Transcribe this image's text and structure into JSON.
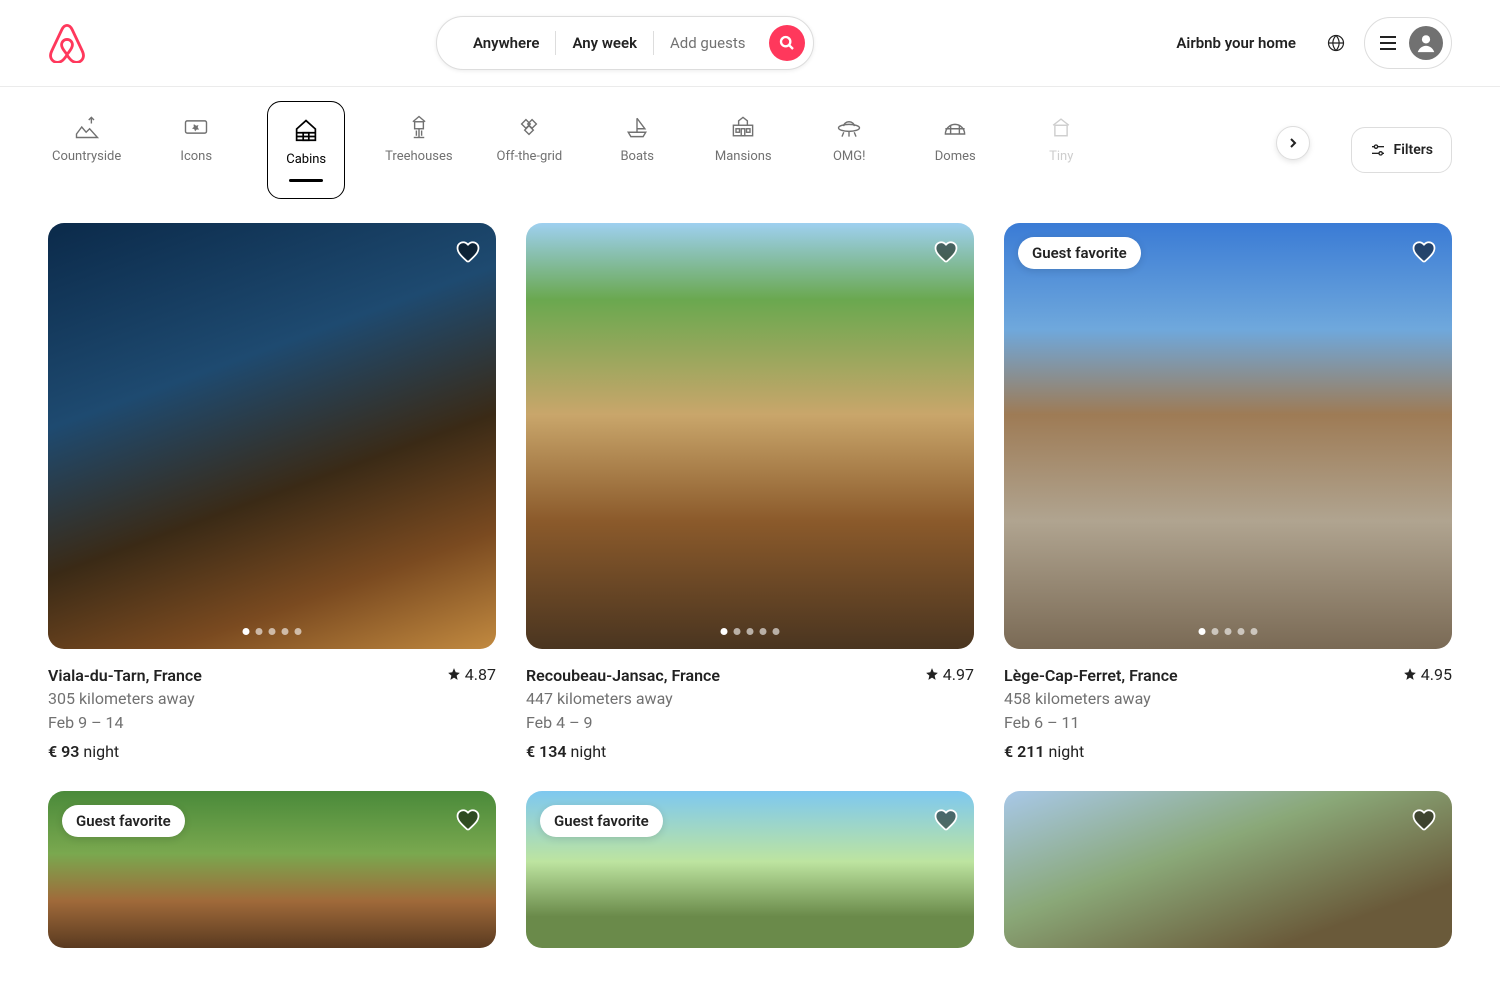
{
  "colors": {
    "accent": "#FF385C"
  },
  "header": {
    "search": {
      "where": "Anywhere",
      "when": "Any week",
      "who": "Add guests"
    },
    "host_link": "Airbnb your home"
  },
  "categories": {
    "active_index": 2,
    "items": [
      {
        "label": "Countryside",
        "icon": "countryside"
      },
      {
        "label": "Icons",
        "icon": "icons"
      },
      {
        "label": "Cabins",
        "icon": "cabins"
      },
      {
        "label": "Treehouses",
        "icon": "treehouses"
      },
      {
        "label": "Off-the-grid",
        "icon": "offgrid"
      },
      {
        "label": "Boats",
        "icon": "boats"
      },
      {
        "label": "Mansions",
        "icon": "mansions"
      },
      {
        "label": "OMG!",
        "icon": "omg"
      },
      {
        "label": "Domes",
        "icon": "domes"
      },
      {
        "label": "Tiny",
        "icon": "tiny"
      }
    ],
    "filters_label": "Filters"
  },
  "listings": [
    {
      "location": "Viala-du-Tarn, France",
      "rating": "4.87",
      "distance": "305 kilometers away",
      "dates": "Feb 9 – 14",
      "price_amount": "€ 93",
      "price_unit": "night",
      "badge": null
    },
    {
      "location": "Recoubeau-Jansac, France",
      "rating": "4.97",
      "distance": "447 kilometers away",
      "dates": "Feb 4 – 9",
      "price_amount": "€ 134",
      "price_unit": "night",
      "badge": null
    },
    {
      "location": "Lège-Cap-Ferret, France",
      "rating": "4.95",
      "distance": "458 kilometers away",
      "dates": "Feb 6 – 11",
      "price_amount": "€ 211",
      "price_unit": "night",
      "badge": "Guest favorite"
    },
    {
      "location": "",
      "rating": "",
      "distance": "",
      "dates": "",
      "price_amount": "",
      "price_unit": "",
      "badge": "Guest favorite"
    },
    {
      "location": "",
      "rating": "",
      "distance": "",
      "dates": "",
      "price_amount": "",
      "price_unit": "",
      "badge": "Guest favorite"
    },
    {
      "location": "",
      "rating": "",
      "distance": "",
      "dates": "",
      "price_amount": "",
      "price_unit": "",
      "badge": null
    }
  ]
}
